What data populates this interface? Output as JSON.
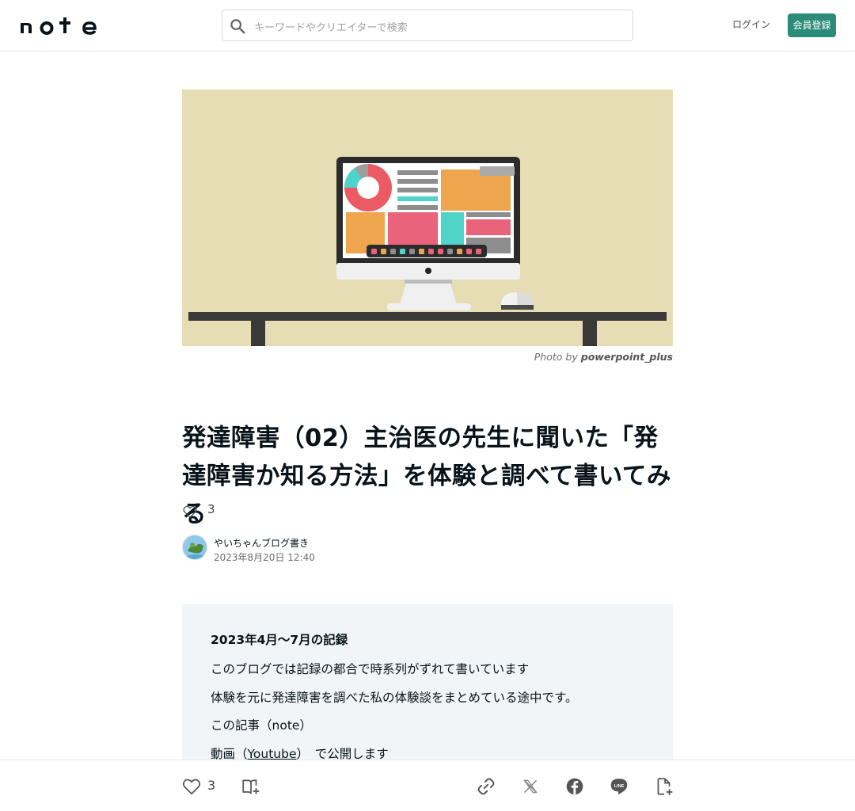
{
  "header": {
    "logo_text": "note",
    "search_placeholder": "キーワードやクリエイターで検索",
    "login_label": "ログイン",
    "signup_label": "会員登録",
    "accent_color": "#2b8c79"
  },
  "hero": {
    "credit_prefix": "Photo by",
    "credit_name": "powerpoint_plus"
  },
  "article": {
    "title": "発達障害（02）主治医の先生に聞いた「発達障害か知る方法」を体験と調べて書いてみる",
    "likes": "3",
    "author_name": "やいちゃんブログ書き",
    "date": "2023年8月20日 12:40"
  },
  "summary": {
    "line1": "2023年4月～7月の記録",
    "line2": "このブログでは記録の都合で時系列がずれて書いています",
    "line3": "体験を元に発達障害を調べた私の体験談をまとめている途中です。",
    "line4_pre": "この記事（",
    "line4_link": "note",
    "line4_post": "）",
    "line5_pre": "動画（",
    "line5_link": "Youtube",
    "line5_post": "）　で公開します"
  },
  "footer": {
    "likes": "3",
    "icons": [
      "heart-icon",
      "magazine-add-icon",
      "link-icon",
      "x-icon",
      "facebook-icon",
      "line-icon",
      "embed-icon"
    ]
  }
}
